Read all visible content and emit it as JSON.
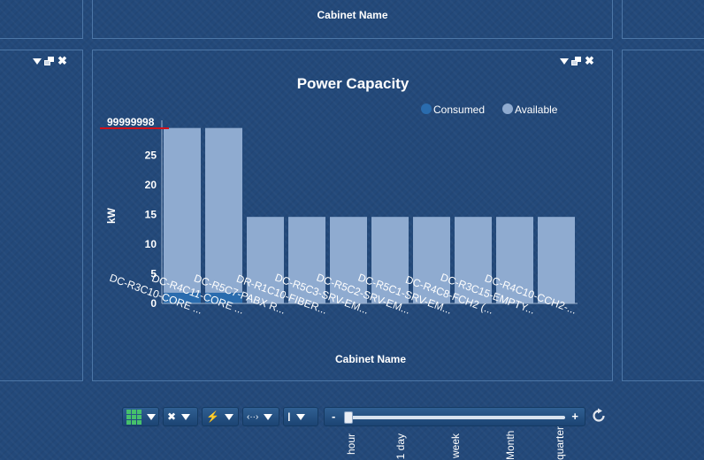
{
  "top_panel": {
    "title": "Cabinet Name"
  },
  "chart_panel": {
    "controls": {
      "menu": "dropdown-icon",
      "restore": "restore-window-icon",
      "close": "close-icon"
    }
  },
  "toolbar": {
    "buttons": [
      {
        "name": "grid-view-button",
        "icon": "grid-icon"
      },
      {
        "name": "fit-view-button",
        "icon": "expand-arrows-icon"
      },
      {
        "name": "power-button",
        "icon": "lightning-icon"
      },
      {
        "name": "horizontal-resize-button",
        "icon": "horizontal-arrows-icon"
      },
      {
        "name": "temperature-button",
        "icon": "thermometer-icon"
      }
    ],
    "slider": {
      "minus": "-",
      "plus": "+",
      "value": 0
    },
    "ticks": [
      "hour",
      "1 day",
      "week",
      "Month",
      "quarter"
    ]
  },
  "chart_data": {
    "type": "bar",
    "stacked": true,
    "title": "Power Capacity",
    "ylabel": "kW",
    "xlabel": "Cabinet Name",
    "ylim": [
      0,
      30
    ],
    "yticks": [
      0,
      5,
      10,
      15,
      20,
      25
    ],
    "annotation": "99999998",
    "legend_position": "top-right",
    "categories": [
      "DC-R3C10-CORE ...",
      "DC-R4C11-CORE ...",
      "DC-R5C7-PABX R...",
      "DR-R1C10-FIBER...",
      "DC-R5C3-SRV-EM...",
      "DC-R5C2-SRV-EM...",
      "DC-R5C1-SRV-EM...",
      "DC-R4C8-FCH2 (...",
      "DC-R3C15-EMPTY...",
      "DC-R4C10-CCH2-..."
    ],
    "series": [
      {
        "name": "Consumed",
        "color": "#2a6cae",
        "values": [
          1.8,
          1.8,
          0,
          0,
          0,
          0,
          0,
          0,
          0,
          0
        ]
      },
      {
        "name": "Available",
        "color": "#8fabd0",
        "values": [
          27.8,
          27.8,
          14.6,
          14.6,
          14.6,
          14.6,
          14.6,
          14.6,
          14.6,
          14.6
        ]
      }
    ]
  }
}
